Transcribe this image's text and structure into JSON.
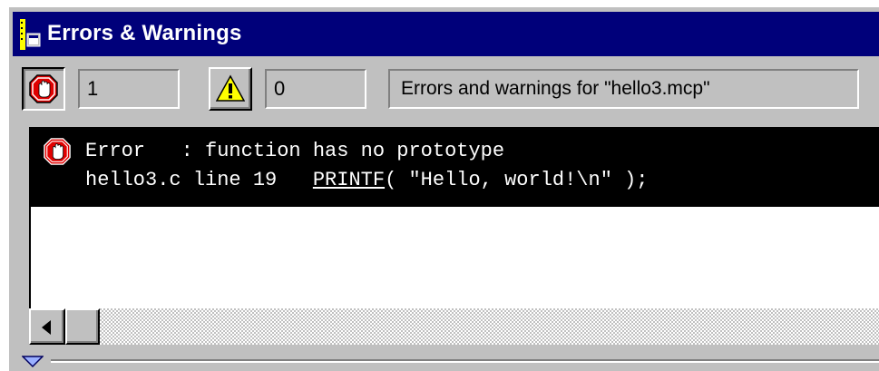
{
  "window": {
    "title": "Errors & Warnings"
  },
  "toolbar": {
    "errors_button_icon": "stop-hand-icon",
    "errors_count": "1",
    "warnings_button_icon": "warning-triangle-icon",
    "warnings_count": "0",
    "message": "Errors and warnings for \"hello3.mcp\""
  },
  "messages": [
    {
      "icon": "stop-hand-icon",
      "line1": "Error   : function has no prototype",
      "file_line": "hello3.c line 19   ",
      "symbol": "PRINTF",
      "rest": "( \"Hello, world!\\n\" );",
      "selected": true
    }
  ],
  "colors": {
    "titlebar": "#00007a",
    "chrome": "#c0c0c0",
    "selection_bg": "#000000",
    "selection_fg": "#ffffff",
    "stop_red": "#e00000",
    "warning_yellow": "#ffff00"
  }
}
